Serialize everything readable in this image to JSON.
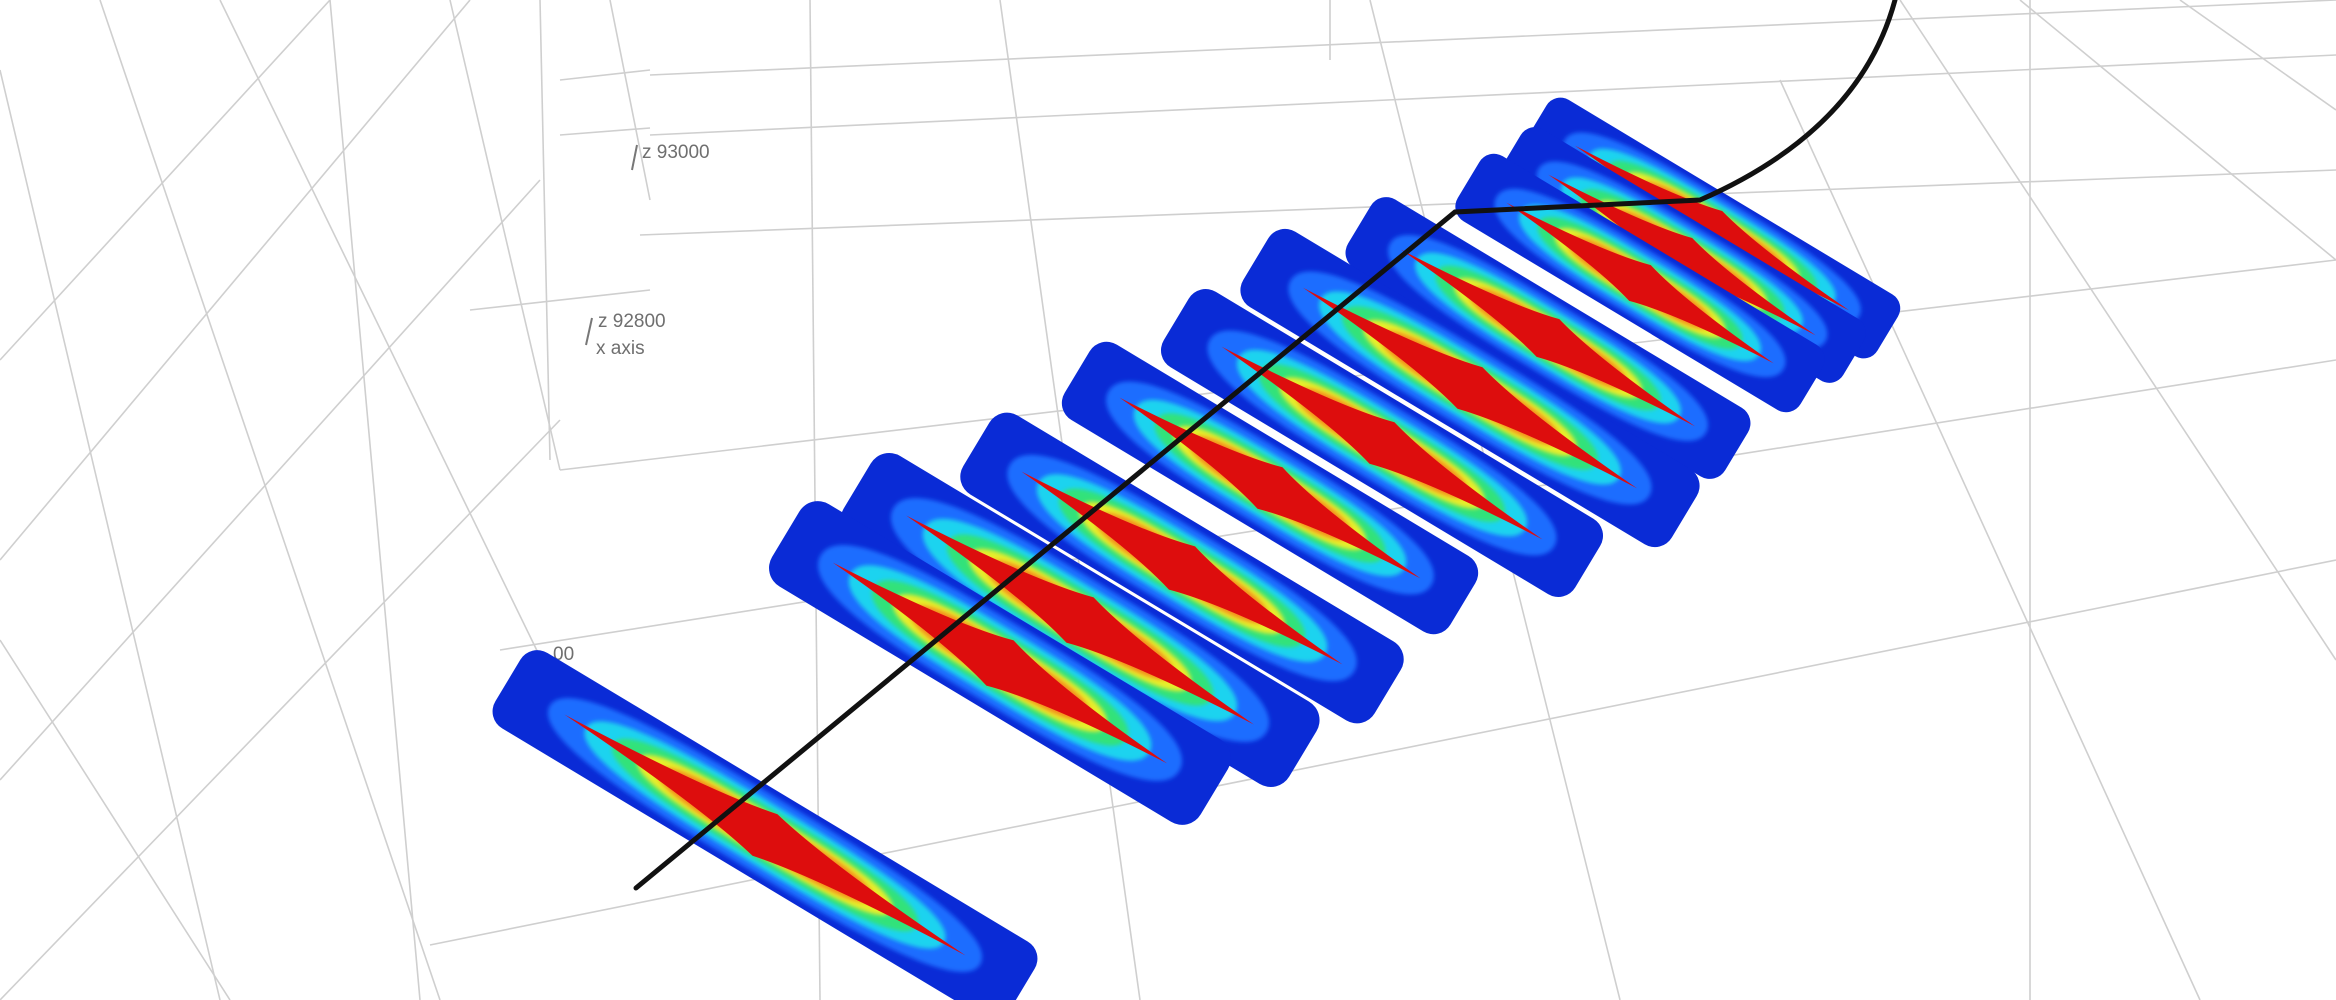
{
  "viewer": {
    "axis_labels": {
      "z_upper": "z 93000",
      "z_lower": "z 92800",
      "x_axis": "x axis",
      "partial_tick": "00"
    },
    "colormap": [
      "#0a2bd6",
      "#1e6dff",
      "#1fd3ef",
      "#33e27a",
      "#e7ee2a",
      "#f58a1c",
      "#dd0d0d"
    ],
    "trajectory_color": "#111111",
    "cross_section_count": 11
  }
}
